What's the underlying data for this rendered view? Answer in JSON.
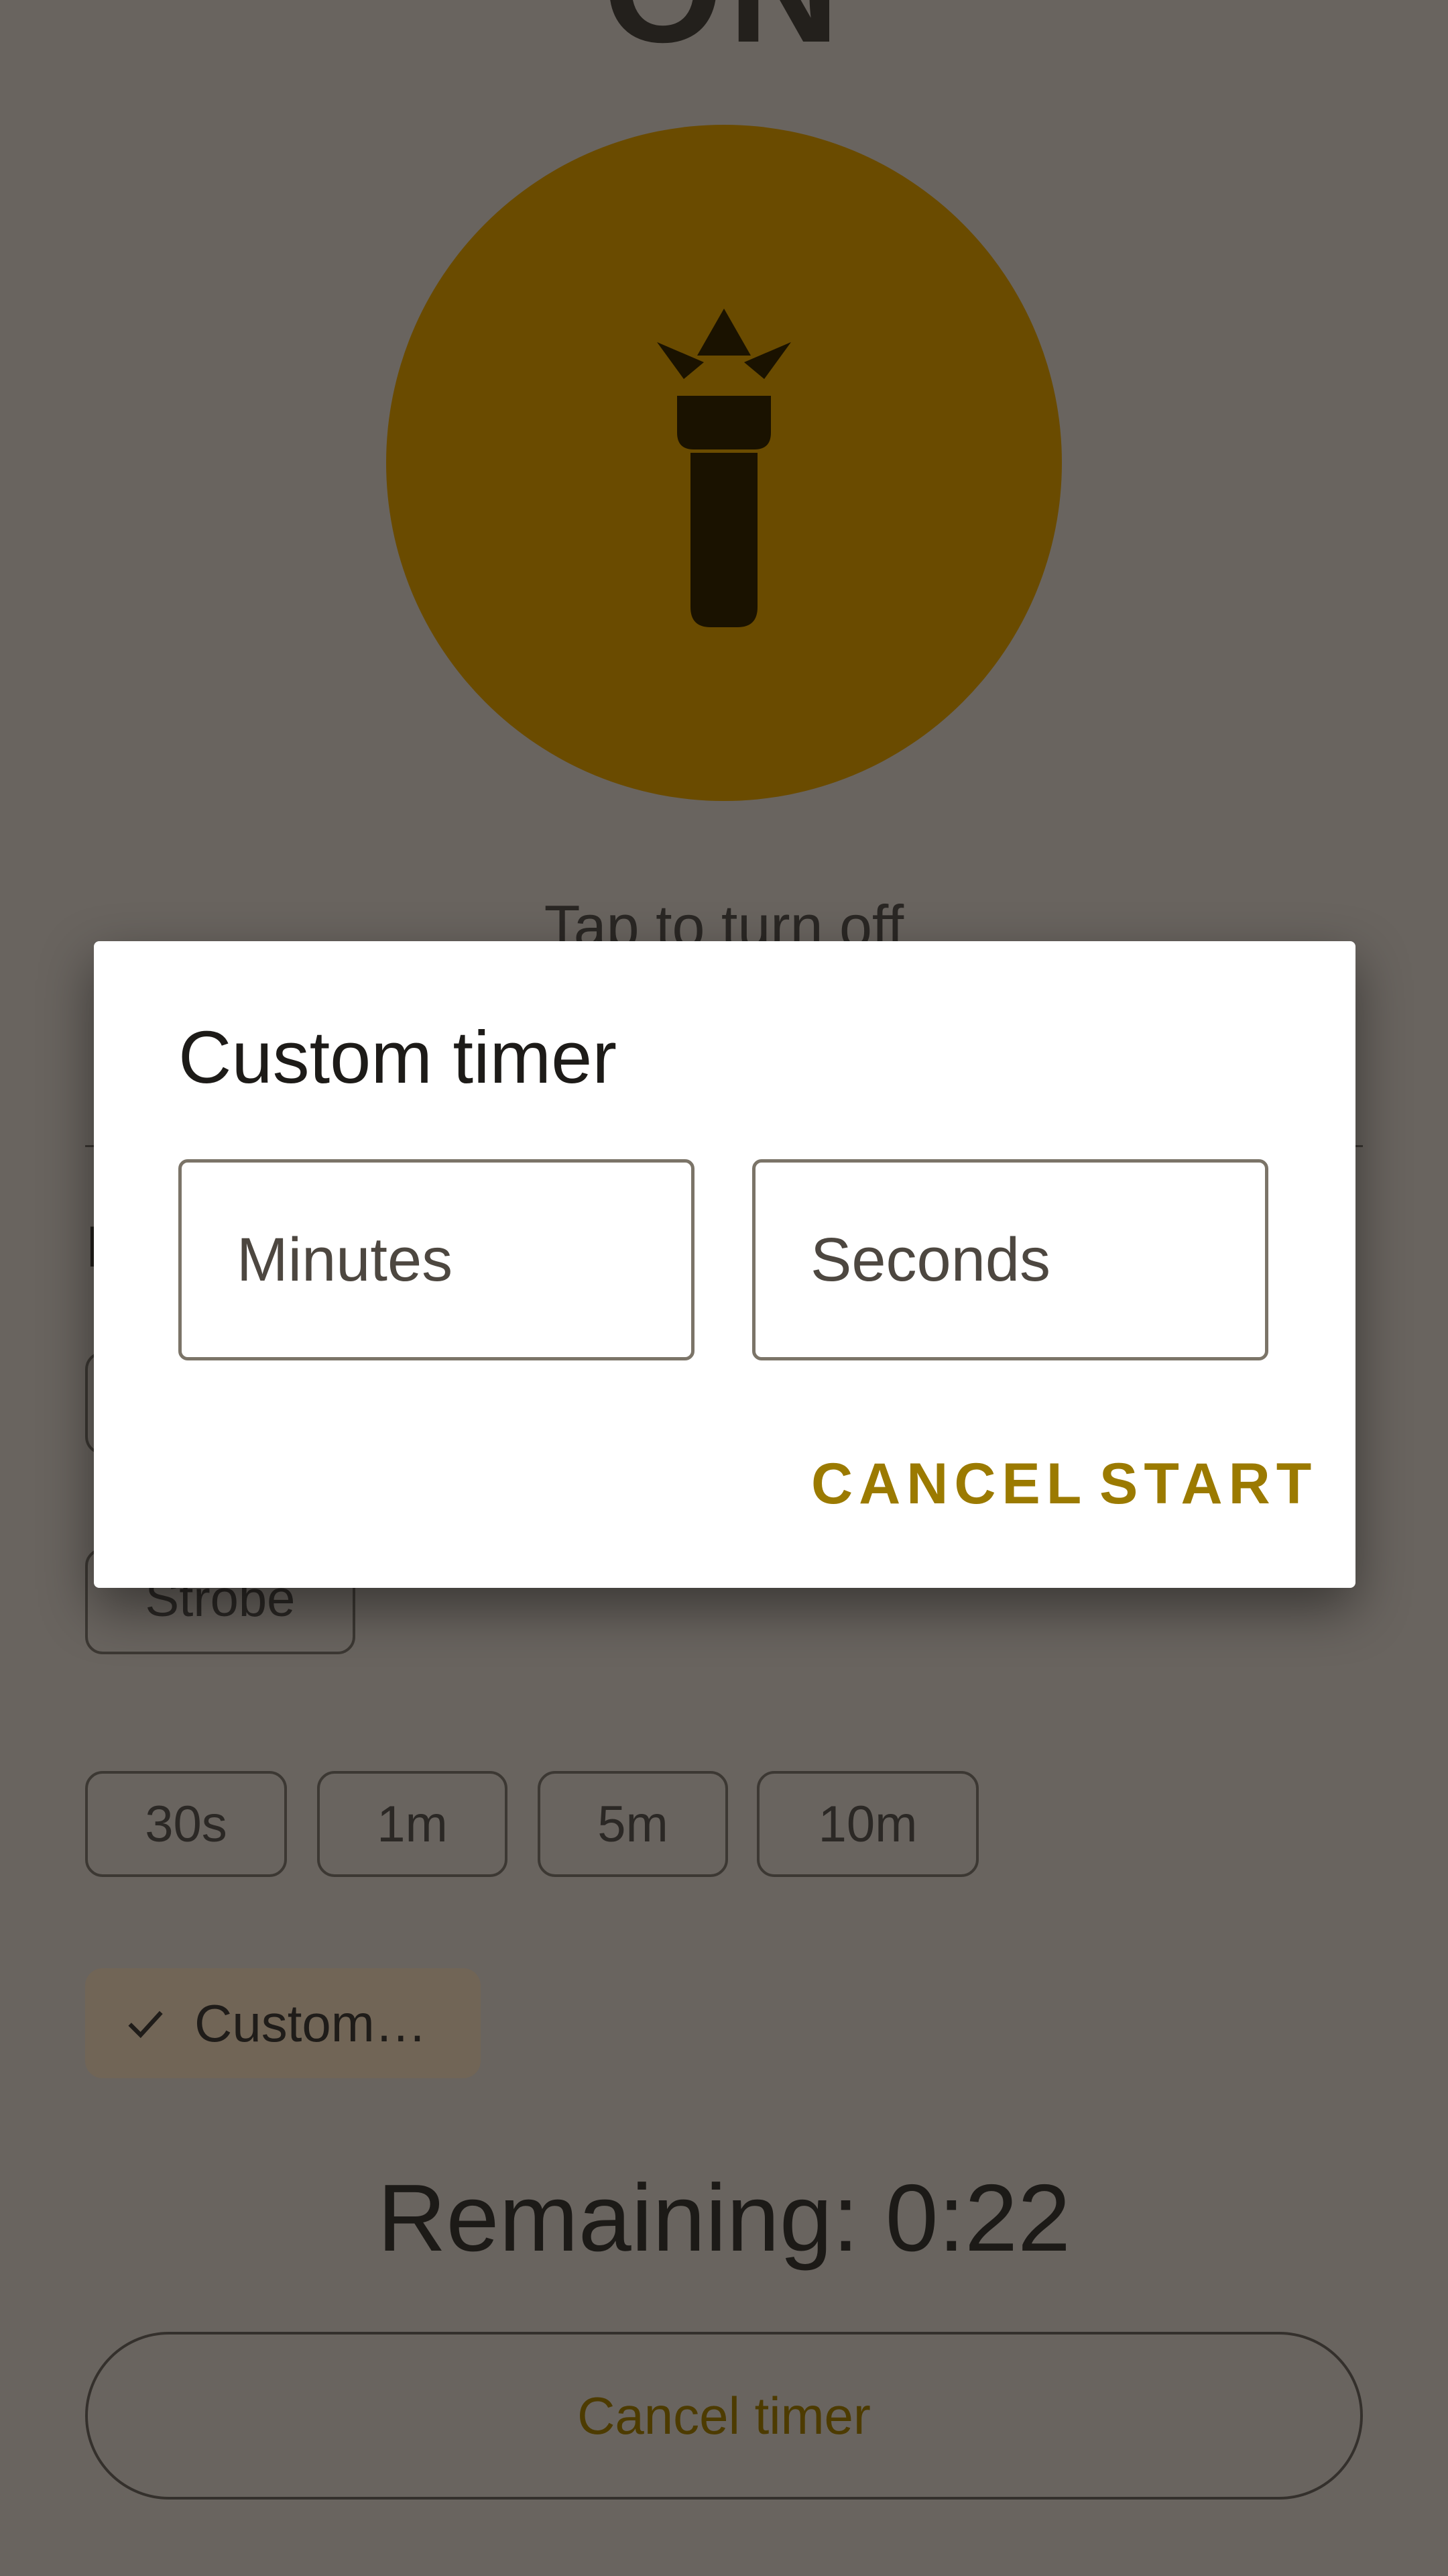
{
  "background": {
    "status_title": "ON",
    "tap_hint": "Tap to turn off",
    "section_letter": "I",
    "mode_chips": [
      "Strobe"
    ],
    "timer_chips": [
      "30s",
      "1m",
      "5m",
      "10m"
    ],
    "custom_chip": "Custom…",
    "remaining": "Remaining: 0:22",
    "cancel_timer": "Cancel timer"
  },
  "dialog": {
    "title": "Custom timer",
    "minutes_placeholder": "Minutes",
    "seconds_placeholder": "Seconds",
    "cancel_label": "CANCEL",
    "start_label": "START"
  },
  "colors": {
    "scrim": "#69645f",
    "power_circle": "#6a4b00",
    "accent": "#9b7a00",
    "dialog_bg": "#ffffff"
  },
  "icons": [
    "flashlight-icon",
    "check-icon"
  ]
}
